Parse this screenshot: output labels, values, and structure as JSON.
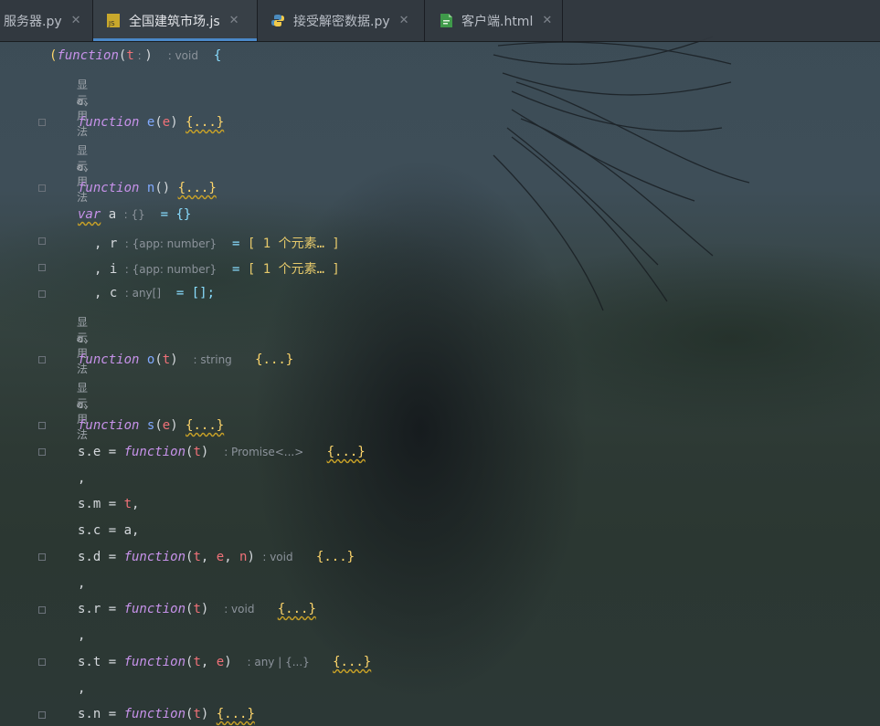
{
  "tabs": [
    {
      "label": "服务器.py",
      "close": "✕",
      "icon": "python-file-icon"
    },
    {
      "label": "全国建筑市场.js",
      "close": "✕",
      "icon": "javascript-file-icon",
      "active": true
    },
    {
      "label": "接受解密数据.py",
      "close": "✕",
      "icon": "python-file-icon"
    },
    {
      "label": "客户端.html",
      "close": "✕",
      "icon": "html-file-icon"
    }
  ],
  "js_badge": "JS",
  "usage_label": "显示用法",
  "code": {
    "iife_open": "(",
    "kw_function": "function",
    "iife_param": "t",
    "iife_param_hint": " : ",
    "iife_close": ")",
    "hint_void": ": void",
    "brace_open": "{",
    "fn_e_name": "e",
    "fn_e_param": "e",
    "fold": "{...}",
    "fn_n_name": "n",
    "empty_parens": "()",
    "kw_var": "var",
    "var_a": "a",
    "hint_obj": ": {}",
    "assign_empty_obj": "= {}",
    "comma_r": ", r",
    "hint_app": ": {app: number}",
    "assign_eq": "= ",
    "arr_r": "[ 1 个元素… ]",
    "comma_i": ", i",
    "arr_i": "[ 1 个元素… ]",
    "comma_c": ", c",
    "hint_anyarr": ": any[]",
    "assign_arr": "= [];",
    "fn_o_name": "o",
    "fn_o_param": "t",
    "hint_string": ": string",
    "fn_s_name": "s",
    "fn_s_param": "e",
    "se_lhs": "s.e = ",
    "se_param": "t",
    "hint_promise": ": Promise<...>",
    "comma": ",",
    "sm_lhs": "s.m = ",
    "sm_rhs": "t",
    "sm_end": ",",
    "sc_line": "s.c = a,",
    "sd_lhs": "s.d = ",
    "sd_p1": "t",
    "sd_p2": "e",
    "sd_p3": "n",
    "sep": ", ",
    "sr_lhs": "s.r = ",
    "sr_param": "t",
    "st_lhs": "s.t = ",
    "st_p1": "t",
    "st_p2": "e",
    "hint_anyobj": ": any | {...}",
    "sn_lhs": "s.n = ",
    "sn_param": "t"
  },
  "colors": {
    "keyword": "#c792ea",
    "function_name": "#82aaff",
    "parameter": "#f07178",
    "fold": "#ffd66b",
    "hint": "#8c939b",
    "tab_accent": "#4a88c7"
  }
}
